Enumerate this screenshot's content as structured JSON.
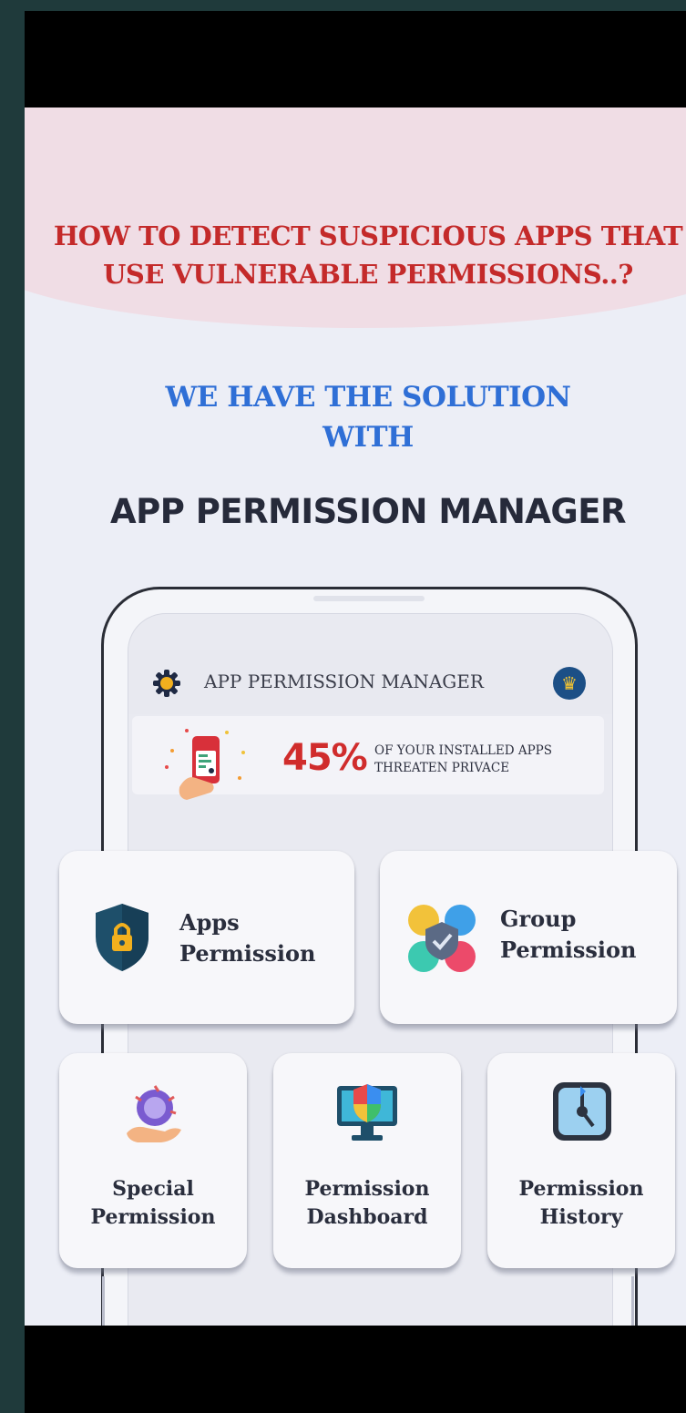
{
  "promo": {
    "headline_line1": "HOW TO DETECT SUSPICIOUS APPS THAT",
    "headline_line2": "USE VULNERABLE PERMISSIONS..?",
    "solution_line1": "WE HAVE THE SOLUTION",
    "solution_line2": "WITH",
    "app_name": "APP PERMISSION MANAGER"
  },
  "phone": {
    "header_title": "APP PERMISSION MANAGER",
    "settings_icon": "gear-icon",
    "premium_icon": "crown-icon",
    "banner": {
      "percent": "45%",
      "text_line1": "OF YOUR INSTALLED APPS",
      "text_line2": "THREATEN PRIVACE"
    }
  },
  "cards": [
    {
      "line1": "Apps",
      "line2": "Permission",
      "icon": "shield-lock-icon"
    },
    {
      "line1": "Group",
      "line2": "Permission",
      "icon": "group-circles-icon"
    },
    {
      "line1": "Special",
      "line2": "Permission",
      "icon": "hand-badge-icon"
    },
    {
      "line1": "Permission",
      "line2": "Dashboard",
      "icon": "monitor-shield-icon"
    },
    {
      "line1": "Permission",
      "line2": "History",
      "icon": "clock-icon"
    }
  ],
  "colors": {
    "headline": "#c42a2a",
    "solution": "#2f6fd6",
    "app_name": "#262a3a",
    "percent": "#d02c2c",
    "background": "#eceef6",
    "wave": "#f0dde5"
  }
}
